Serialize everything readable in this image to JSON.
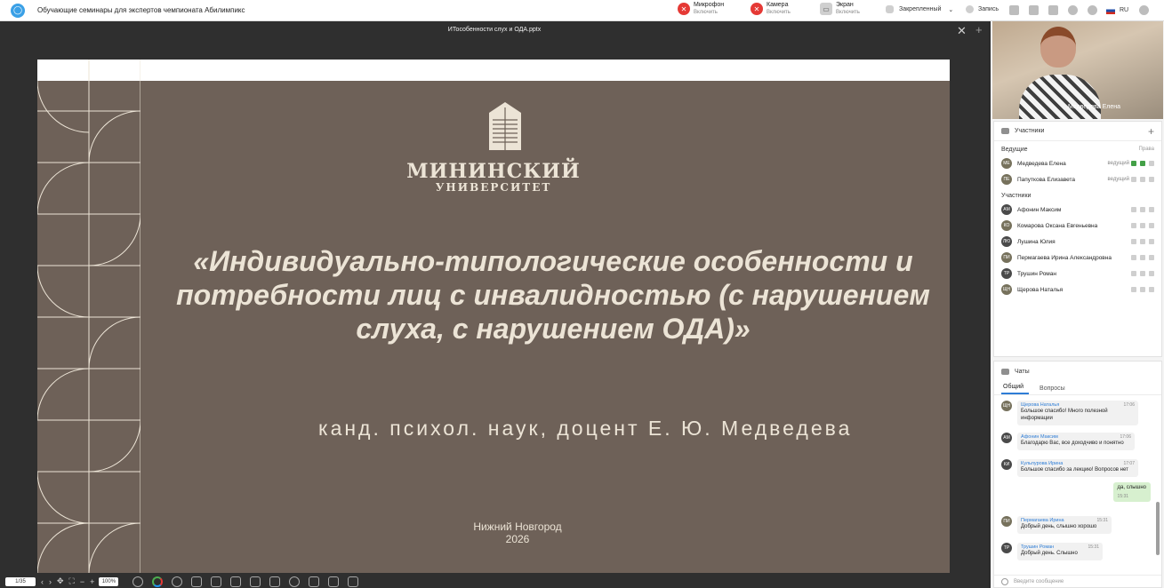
{
  "window": {
    "title": "Обучающие семинары для экспертов чемпионата Абилимпикс"
  },
  "topbar": {
    "mic": {
      "label": "Микрофон",
      "sub": "Включить"
    },
    "camera": {
      "label": "Камера",
      "sub": "Включить"
    },
    "screen": {
      "label": "Экран",
      "sub": "Включить"
    },
    "pinned": "Закрепленный",
    "record": "Запись",
    "lang": "RU"
  },
  "presentation": {
    "filename": "ИТособенности слух и ОДА.pptx",
    "page": "1/35",
    "zoom": "100%"
  },
  "slide": {
    "university_line1": "МИНИНСКИЙ",
    "university_line2": "УНИВЕРСИТЕТ",
    "headline": "«Индивидуально-типологические особенности и потребности лиц с инвалидностью (с нарушением слуха, с нарушением ОДА)»",
    "author": "канд. психол. наук, доцент Е. Ю. Медведева",
    "city": "Нижний Новгород",
    "year": "2026"
  },
  "video": {
    "name": "Медведева Елена"
  },
  "participants": {
    "title": "Участники",
    "hosts_label": "Ведущие",
    "rights_label": "Права",
    "participants_label": "Участники",
    "hosts": [
      {
        "initials": "МЕ",
        "name": "Медведева Елена",
        "role": "ведущий"
      },
      {
        "initials": "ПЕ",
        "name": "Папуткова Елизавета",
        "role": "ведущий"
      }
    ],
    "list": [
      {
        "initials": "АМ",
        "name": "Афонин Максим"
      },
      {
        "initials": "КО",
        "name": "Комарова Оксана Евгеньевна"
      },
      {
        "initials": "ЛЮ",
        "name": "Лушина Юлия"
      },
      {
        "initials": "ПИ",
        "name": "Пермагаева Ирина Александровна"
      },
      {
        "initials": "ТР",
        "name": "Трушин Роман"
      },
      {
        "initials": "ЩН",
        "name": "Щерова Наталья"
      }
    ]
  },
  "chat": {
    "title": "Чаты",
    "tabs": [
      "Общий",
      "Вопросы"
    ],
    "messages": [
      {
        "initials": "ЩН",
        "author": "Щерова Наталья",
        "time": "17:06",
        "text1": "Большое спасибо! Много полезной",
        "text2": "информации"
      },
      {
        "initials": "АМ",
        "author": "Афонин Максим",
        "time": "17:06",
        "text1": "Благодарю Вас, все доходчиво и понятно",
        "text2": ""
      },
      {
        "initials": "КИ",
        "author": "Кульпурова Ирина",
        "time": "17:07",
        "text1": "Большое спасибо за лекцию! Вопросов нет",
        "text2": ""
      },
      {
        "initials": "ПИ",
        "author": "Пермагаева Ирина",
        "time": "15:31",
        "text1": "Добрый день, слышно хорошо",
        "text2": ""
      },
      {
        "initials": "ТР",
        "author": "Трушин Роман",
        "time": "15:31",
        "text1": "Добрый день. Слышно",
        "text2": ""
      }
    ],
    "mine": {
      "text": "да, слышно",
      "time": "15:31"
    },
    "input_placeholder": "Введите сообщение"
  }
}
